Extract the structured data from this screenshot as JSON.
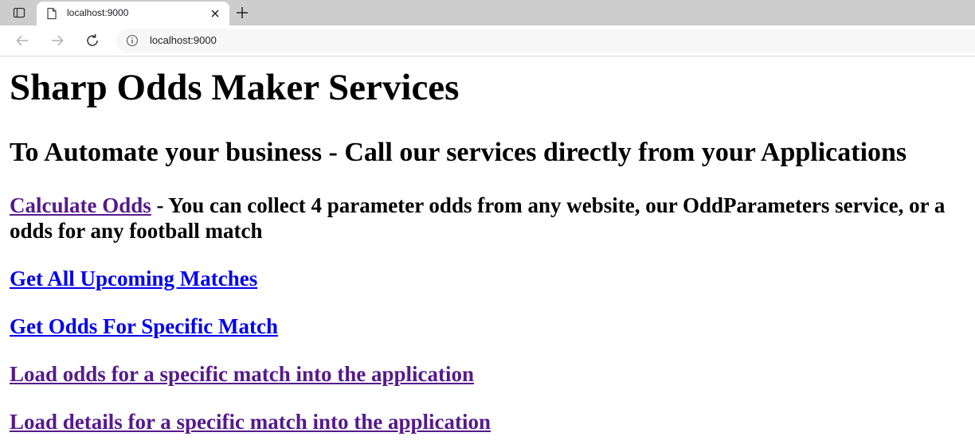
{
  "browser": {
    "tab_title": "localhost:9000",
    "url": "localhost:9000"
  },
  "page": {
    "title": "Sharp Odds Maker Services",
    "subtitle": "To Automate your business - Call our services directly from your Applications",
    "calculate": {
      "link": "Calculate Odds",
      "description_line1": " - You can collect 4 parameter odds from any website, our OddParameters service, or a",
      "description_line2": "odds for any football match"
    },
    "links": [
      "Get All Upcoming Matches",
      "Get Odds For Specific Match",
      "Load odds for a specific match into the application",
      "Load details for a specific match into the application"
    ]
  },
  "colors": {
    "link": "#0000ee",
    "visited_link": "#551a8b",
    "tabstrip": "#cdcdcd"
  }
}
